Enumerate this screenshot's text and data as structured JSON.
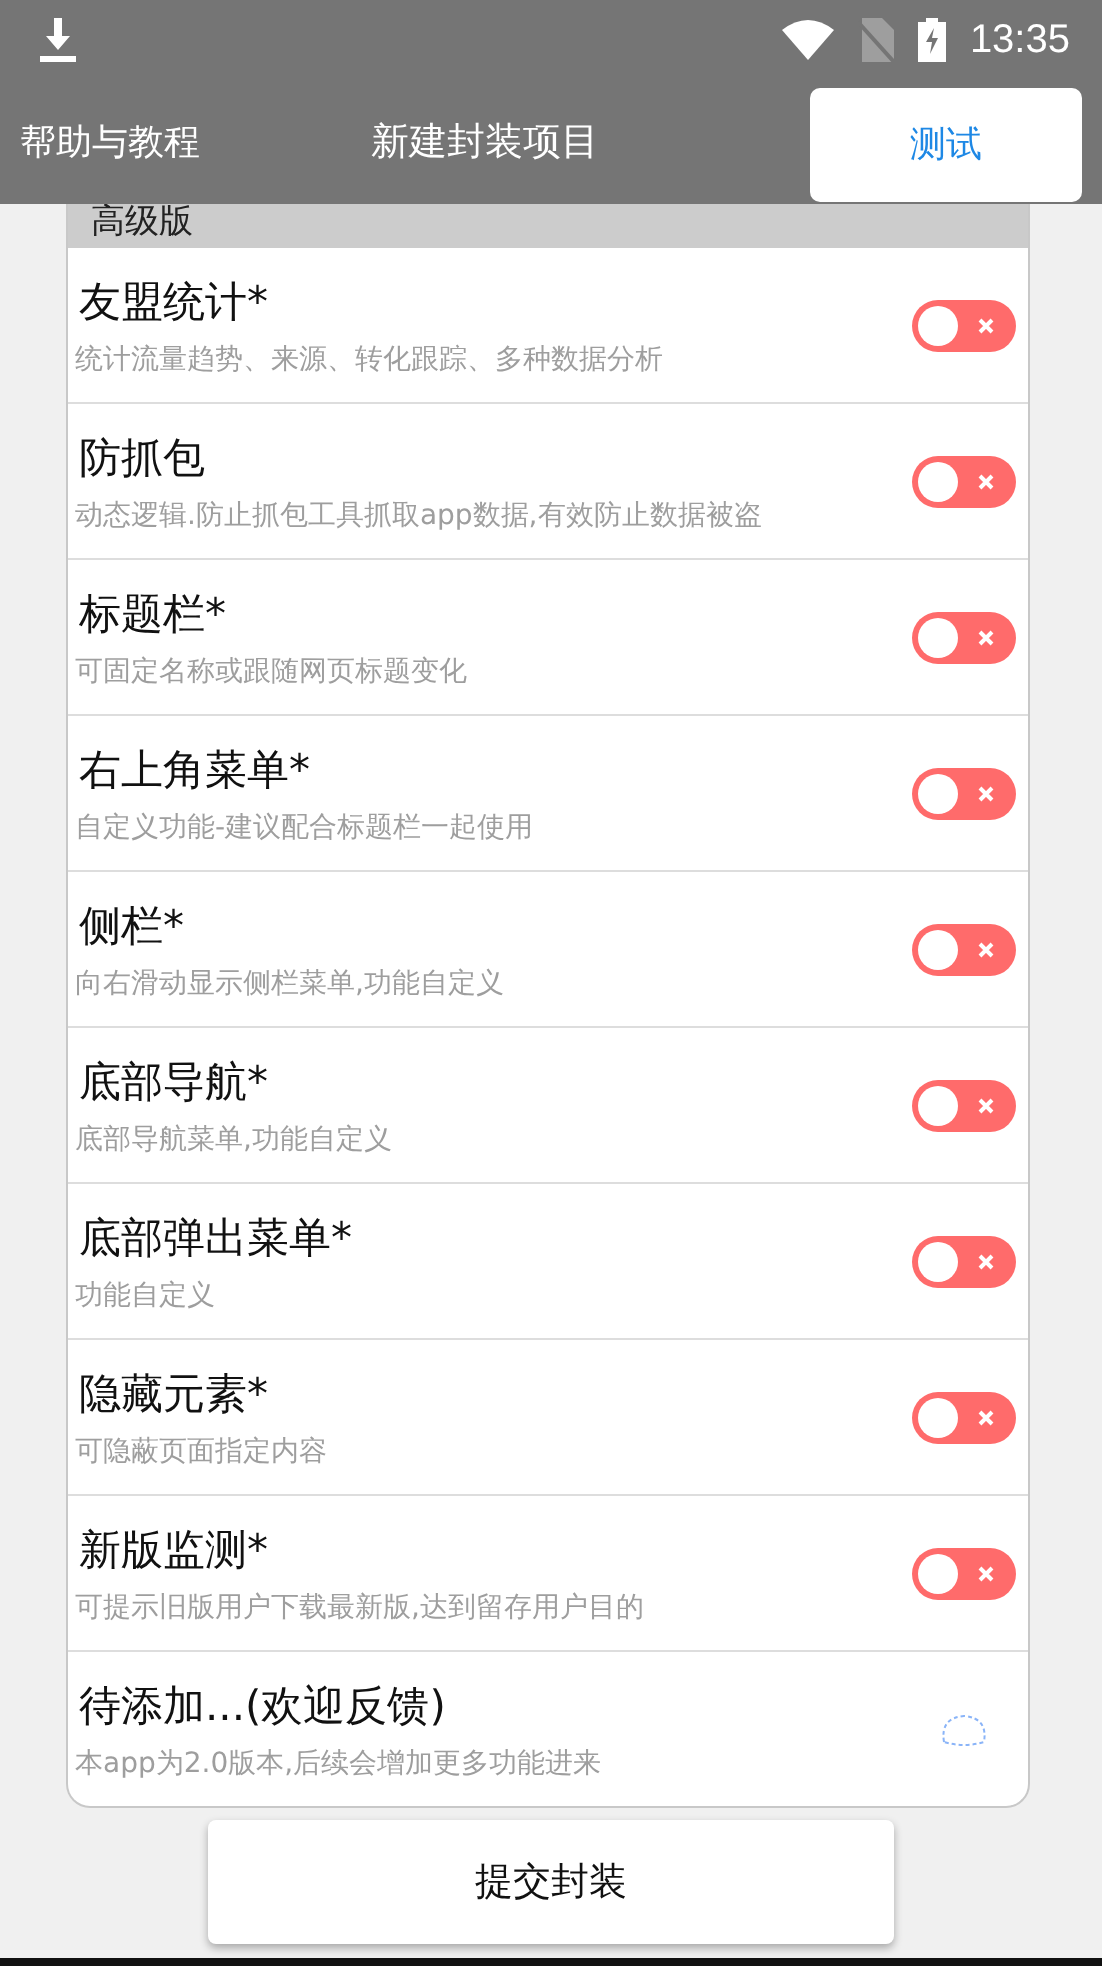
{
  "status_bar": {
    "time": "13:35"
  },
  "app_bar": {
    "left": "帮助与教程",
    "title": "新建封装项目",
    "button": "测试"
  },
  "section": {
    "title": "高级版"
  },
  "features": [
    {
      "kind": "switch",
      "title": "友盟统计*",
      "description": "统计流量趋势、来源、转化跟踪、多种数据分析",
      "on": false
    },
    {
      "kind": "switch",
      "title": "防抓包",
      "description": "动态逻辑.防止抓包工具抓取app数据,有效防止数据被盗",
      "on": false
    },
    {
      "kind": "switch",
      "title": "标题栏*",
      "description": "可固定名称或跟随网页标题变化",
      "on": false
    },
    {
      "kind": "switch",
      "title": "右上角菜单*",
      "description": "自定义功能-建议配合标题栏一起使用",
      "on": false
    },
    {
      "kind": "switch",
      "title": "侧栏*",
      "description": "向右滑动显示侧栏菜单,功能自定义",
      "on": false
    },
    {
      "kind": "switch",
      "title": "底部导航*",
      "description": "底部导航菜单,功能自定义",
      "on": false
    },
    {
      "kind": "switch",
      "title": "底部弹出菜单*",
      "description": "功能自定义",
      "on": false
    },
    {
      "kind": "switch",
      "title": "隐藏元素*",
      "description": "可隐蔽页面指定内容",
      "on": false
    },
    {
      "kind": "switch",
      "title": "新版监测*",
      "description": "可提示旧版用户下载最新版,达到留存用户目的",
      "on": false
    },
    {
      "kind": "loading",
      "title": "待添加...(欢迎反馈)",
      "description": "本app为2.0版本,后续会增加更多功能进来"
    }
  ],
  "submit_button": "提交封装"
}
